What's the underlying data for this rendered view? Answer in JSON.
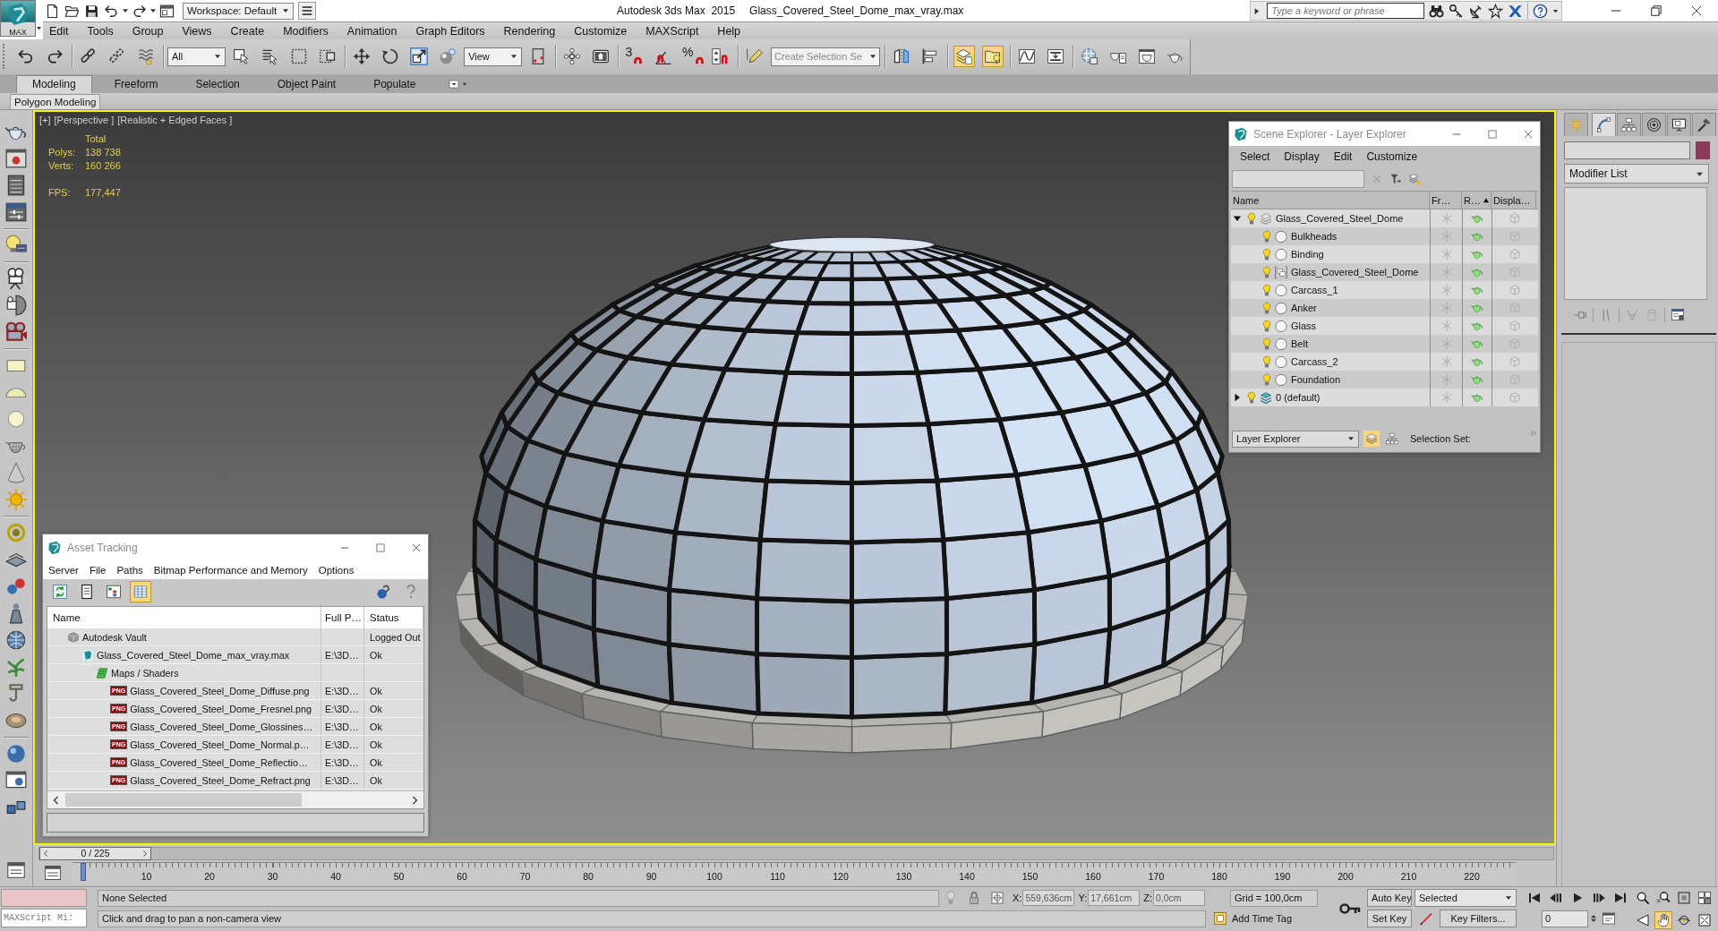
{
  "title_bar": {
    "app_button": "MAX",
    "workspace": "Workspace: Default",
    "app_title": "Autodesk 3ds Max  2015",
    "file_name": "Glass_Covered_Steel_Dome_max_vray.max",
    "search": {
      "placeholder": "Type a keyword or phrase"
    }
  },
  "menu_bar": [
    "Edit",
    "Tools",
    "Group",
    "Views",
    "Create",
    "Modifiers",
    "Animation",
    "Graph Editors",
    "Rendering",
    "Customize",
    "MAXScript",
    "Help"
  ],
  "main_toolbar": {
    "groups": [
      [
        {
          "kind": "undo",
          "on": false
        },
        {
          "kind": "redo",
          "on": false
        }
      ],
      [
        {
          "kind": "link",
          "on": false
        },
        {
          "kind": "unlink",
          "on": false
        },
        {
          "kind": "bind",
          "on": false
        }
      ],
      [
        {
          "kind": "dropdown",
          "value": "All"
        },
        {
          "kind": "select",
          "on": false
        },
        {
          "kind": "select_by_name",
          "on": false
        },
        {
          "kind": "rect_region",
          "on": false
        },
        {
          "kind": "window_crossing",
          "on": false
        }
      ],
      [
        {
          "kind": "move",
          "on": false
        },
        {
          "kind": "rotate",
          "on": false
        },
        {
          "kind": "scale",
          "on": false
        },
        {
          "kind": "manipulate",
          "on": false
        },
        {
          "kind": "dropdown",
          "value": "View"
        },
        {
          "kind": "pivot",
          "on": false
        }
      ],
      [
        {
          "kind": "axis",
          "on": false
        },
        {
          "kind": "keyboard",
          "on": false
        }
      ],
      [
        {
          "kind": "snap",
          "label": "3",
          "on": false
        },
        {
          "kind": "angle_snap",
          "on": false
        },
        {
          "kind": "snap",
          "label": "%",
          "on": false
        },
        {
          "kind": "spinner_snap",
          "on": false
        }
      ],
      [
        {
          "kind": "edit_named",
          "on": false
        },
        {
          "kind": "dropdown",
          "placeholder": "Create Selection Se"
        }
      ],
      [
        {
          "kind": "mirror",
          "on": false
        },
        {
          "kind": "align",
          "on": false
        }
      ],
      [
        {
          "kind": "scene_explorer",
          "on": true
        },
        {
          "kind": "layer_explorer",
          "on": true
        }
      ],
      [
        {
          "kind": "curve_editor",
          "on": false
        },
        {
          "kind": "schematic",
          "on": false
        }
      ],
      [
        {
          "kind": "material",
          "on": false
        },
        {
          "kind": "render_setup",
          "on": false
        },
        {
          "kind": "render_frame",
          "on": false
        },
        {
          "kind": "render",
          "on": false
        }
      ]
    ]
  },
  "ribbon": {
    "tabs": [
      {
        "label": "Modeling",
        "selected": true
      },
      {
        "label": "Freeform",
        "selected": false
      },
      {
        "label": "Selection",
        "selected": false
      },
      {
        "label": "Object Paint",
        "selected": false
      },
      {
        "label": "Populate",
        "selected": false
      }
    ],
    "panel": "Polygon Modeling"
  },
  "viewport": {
    "labels": [
      "[+]",
      "[Perspective ]",
      "[Realistic + Edged Faces ]"
    ],
    "stats": {
      "header": "Total",
      "rows": [
        {
          "label": "Polys:",
          "value": "138 738"
        },
        {
          "label": "Verts:",
          "value": "160 266"
        }
      ],
      "fps": {
        "label": "FPS:",
        "value": "177,447"
      }
    }
  },
  "scene_explorer": {
    "title": "Scene Explorer - Layer Explorer",
    "menu": [
      "Select",
      "Display",
      "Edit",
      "Customize"
    ],
    "columns": [
      {
        "label": "Name",
        "sorted": false
      },
      {
        "label": "Fr…",
        "sorted": false
      },
      {
        "label": "R…",
        "sorted": true
      },
      {
        "label": "Displa…",
        "sorted": false
      }
    ],
    "rows": [
      {
        "kind": "layer",
        "name": "Glass_Covered_Steel_Dome",
        "expanded": true,
        "active": false,
        "visible": true,
        "frozen": false,
        "renderable": true,
        "selected": false,
        "children": [
          {
            "kind": "object",
            "name": "Bulkheads",
            "visible": true,
            "frozen": false,
            "renderable": true,
            "selected": false
          },
          {
            "kind": "object",
            "name": "Binding",
            "visible": true,
            "frozen": false,
            "renderable": true,
            "selected": false
          },
          {
            "kind": "group",
            "name": "Glass_Covered_Steel_Dome",
            "visible": true,
            "frozen": false,
            "renderable": true,
            "selected": false
          },
          {
            "kind": "object",
            "name": "Carcass_1",
            "visible": true,
            "frozen": false,
            "renderable": true,
            "selected": false
          },
          {
            "kind": "object",
            "name": "Anker",
            "visible": true,
            "frozen": false,
            "renderable": true,
            "selected": false
          },
          {
            "kind": "object",
            "name": "Glass",
            "visible": true,
            "frozen": false,
            "renderable": true,
            "selected": false
          },
          {
            "kind": "object",
            "name": "Belt",
            "visible": true,
            "frozen": false,
            "renderable": true,
            "selected": false
          },
          {
            "kind": "object",
            "name": "Carcass_2",
            "visible": true,
            "frozen": false,
            "renderable": true,
            "selected": false
          },
          {
            "kind": "object",
            "name": "Foundation",
            "visible": true,
            "frozen": false,
            "renderable": true,
            "selected": false
          }
        ]
      },
      {
        "kind": "layer",
        "name": "0 (default)",
        "expanded": false,
        "active": true,
        "visible": true,
        "frozen": false,
        "renderable": true,
        "selected": false
      }
    ],
    "footer": {
      "mode": "Layer Explorer",
      "tools": [
        {
          "kind": "layers",
          "on": true
        },
        {
          "kind": "hierarchy",
          "on": false
        }
      ],
      "selection_set": "Selection Set:"
    }
  },
  "asset_tracking": {
    "title": "Asset Tracking",
    "menu": [
      "Server",
      "File",
      "Paths",
      "Bitmap Performance and Memory",
      "Options"
    ],
    "tools": [
      {
        "kind": "refresh",
        "on": false
      },
      {
        "kind": "list",
        "on": false
      },
      {
        "kind": "thumbnails",
        "on": false
      },
      {
        "kind": "table",
        "on": true
      }
    ],
    "columns": [
      "Name",
      "Full P…",
      "Status"
    ],
    "rows": [
      {
        "kind": "vault",
        "name": "Autodesk Vault",
        "status": "Logged Out",
        "selected": false,
        "children": [
          {
            "kind": "max",
            "name": "Glass_Covered_Steel_Dome_max_vray.max",
            "path": "E:\\3D…",
            "status": "Ok",
            "selected": false,
            "children": [
              {
                "kind": "folder",
                "name": "Maps / Shaders",
                "selected": false,
                "children": [
                  {
                    "kind": "png",
                    "badge": "PNG",
                    "name": "Glass_Covered_Steel_Dome_Diffuse.png",
                    "path": "E:\\3D…",
                    "status": "Ok",
                    "selected": false
                  },
                  {
                    "kind": "png",
                    "badge": "PNG",
                    "name": "Glass_Covered_Steel_Dome_Fresnel.png",
                    "path": "E:\\3D…",
                    "status": "Ok",
                    "selected": false
                  },
                  {
                    "kind": "png",
                    "badge": "PNG",
                    "name": "Glass_Covered_Steel_Dome_Glossines…",
                    "path": "E:\\3D…",
                    "status": "Ok",
                    "selected": false
                  },
                  {
                    "kind": "png",
                    "badge": "PNG",
                    "name": "Glass_Covered_Steel_Dome_Normal.p…",
                    "path": "E:\\3D…",
                    "status": "Ok",
                    "selected": false
                  },
                  {
                    "kind": "png",
                    "badge": "PNG",
                    "name": "Glass_Covered_Steel_Dome_Reflectio…",
                    "path": "E:\\3D…",
                    "status": "Ok",
                    "selected": false
                  },
                  {
                    "kind": "png",
                    "badge": "PNG",
                    "name": "Glass_Covered_Steel_Dome_Refract.png",
                    "path": "E:\\3D…",
                    "status": "Ok",
                    "selected": false
                  }
                ]
              }
            ]
          }
        ]
      }
    ]
  },
  "command_panel": {
    "tabs": [
      {
        "kind": "create",
        "selected": false
      },
      {
        "kind": "modify",
        "selected": true
      },
      {
        "kind": "hierarchy",
        "selected": false
      },
      {
        "kind": "motion",
        "selected": false
      },
      {
        "kind": "display",
        "selected": false
      },
      {
        "kind": "utilities",
        "selected": false
      }
    ],
    "modifier_list": "Modifier List"
  },
  "timeline": {
    "slider": {
      "label": "0 / 225",
      "level": 0
    },
    "ticks": [
      "10",
      "20",
      "30",
      "40",
      "50",
      "60",
      "70",
      "80",
      "90",
      "100",
      "110",
      "120",
      "130",
      "140",
      "150",
      "160",
      "170",
      "180",
      "190",
      "200",
      "210",
      "220"
    ]
  },
  "status_bar": {
    "listener": {
      "placeholder": "MAXScript Mi:"
    },
    "selection": "None Selected",
    "prompt": "Click and drag to pan a non-camera view",
    "coordinates": [
      {
        "label": "X:",
        "value": "559,636cm"
      },
      {
        "label": "Y:",
        "value": "17,661cm"
      },
      {
        "label": "Z:",
        "value": "0,0cm"
      }
    ],
    "grid": "Grid = 100,0cm",
    "time_tag": "Add Time Tag",
    "auto_key": {
      "label": "Auto Key",
      "on": false
    },
    "set_key": "Set Key",
    "key_mode": "Selected",
    "key_filters": "Key Filters...",
    "frame": "0",
    "nav": [
      {
        "kind": "zoom",
        "on": false
      },
      {
        "kind": "zoom_all",
        "on": false
      },
      {
        "kind": "zoom_extents",
        "on": false
      },
      {
        "kind": "zoom_extents_all",
        "on": false
      },
      {
        "kind": "fov",
        "on": false
      },
      {
        "kind": "pan",
        "on": true
      },
      {
        "kind": "orbit",
        "on": false
      },
      {
        "kind": "maximize",
        "on": false
      }
    ]
  }
}
